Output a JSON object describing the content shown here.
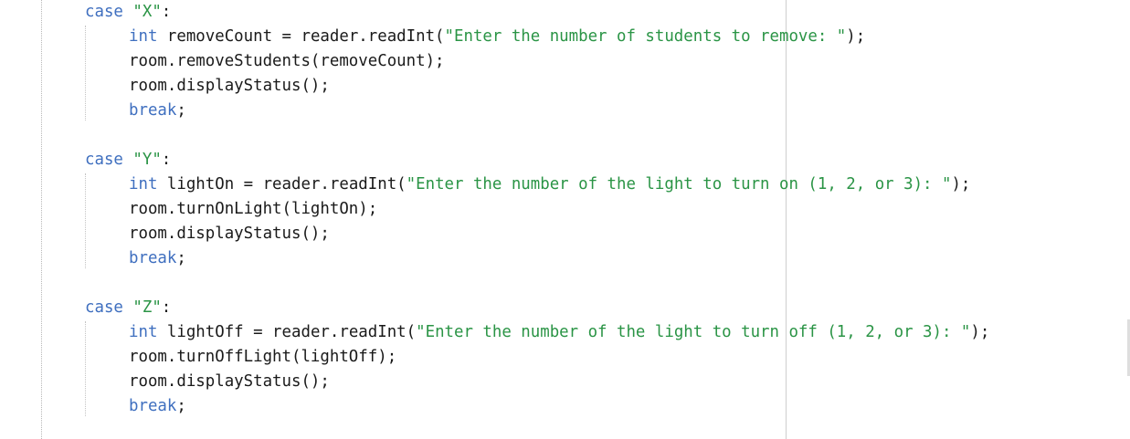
{
  "editor": {
    "colors": {
      "keyword": "#3f6fbf",
      "string": "#2a9445",
      "text": "#1a1a1a",
      "background": "#ffffff"
    },
    "blocks": [
      {
        "case_kw": "case",
        "case_label": "\"X\"",
        "case_colon": ":",
        "decl_type": "int",
        "decl_pre": " removeCount = reader.readInt(",
        "decl_str": "\"Enter the number of students to remove: \"",
        "decl_post": ");",
        "call1": "room.removeStudents(removeCount);",
        "call2": "room.displayStatus();",
        "break_kw": "break",
        "break_semi": ";"
      },
      {
        "case_kw": "case",
        "case_label": "\"Y\"",
        "case_colon": ":",
        "decl_type": "int",
        "decl_pre": " lightOn = reader.readInt(",
        "decl_str": "\"Enter the number of the light to turn on (1, 2, or 3): \"",
        "decl_post": ");",
        "call1": "room.turnOnLight(lightOn);",
        "call2": "room.displayStatus();",
        "break_kw": "break",
        "break_semi": ";"
      },
      {
        "case_kw": "case",
        "case_label": "\"Z\"",
        "case_colon": ":",
        "decl_type": "int",
        "decl_pre": " lightOff = reader.readInt(",
        "decl_str": "\"Enter the number of the light to turn off (1, 2, or 3): \"",
        "decl_post": ");",
        "call1": "room.turnOffLight(lightOff);",
        "call2": "room.displayStatus();",
        "break_kw": "break",
        "break_semi": ";"
      }
    ]
  }
}
